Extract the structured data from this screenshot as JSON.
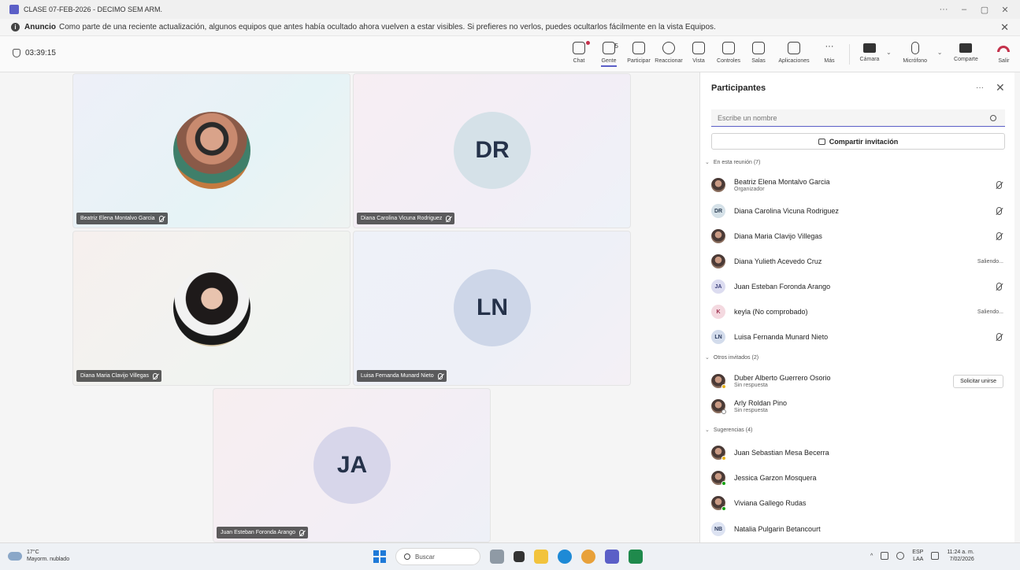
{
  "window": {
    "title": "CLASE 07-FEB-2026 - DECIMO SEM ARM.",
    "controls": [
      "···",
      "–",
      "▢",
      "✕"
    ]
  },
  "announcement": {
    "bold": "Anuncio",
    "text": "Como parte de una reciente actualización, algunos equipos que antes había ocultado ahora vuelven a estar visibles. Si prefieres no verlos, puedes ocultarlos fácilmente en la vista Equipos.",
    "close": "✕"
  },
  "toolbar": {
    "timer": "03:39:15",
    "items": {
      "chat": "Chat",
      "people": "Gente",
      "people_count": "5",
      "raise": "Participar",
      "react": "Reaccionar",
      "view": "Vista",
      "controls": "Controles",
      "rooms": "Salas",
      "apps": "Aplicaciones",
      "more": "Más",
      "camera": "Cámara",
      "mic": "Micrófono",
      "share": "Comparte",
      "leave": "Salir"
    },
    "more_glyph": "···",
    "chevron": "⌄"
  },
  "stage": {
    "tiles": [
      {
        "name": "Beatriz Elena Montalvo Garcia"
      },
      {
        "name": "Diana Carolina Vicuna Rodriguez",
        "initials": "DR"
      },
      {
        "name": "Diana Maria Clavijo Villegas"
      },
      {
        "name": "Luisa Fernanda Munard Nieto",
        "initials": "LN"
      },
      {
        "name": "Juan Esteban Foronda Arango",
        "initials": "JA"
      }
    ]
  },
  "panel": {
    "title": "Participantes",
    "more": "···",
    "close": "✕",
    "search_placeholder": "Escribe un nombre",
    "invite": "Compartir invitación",
    "section_in": "En esta reunión (7)",
    "section_others": "Otros invitados (2)",
    "section_suggest": "Sugerencias (4)",
    "chevron": "⌄",
    "in_meeting": [
      {
        "name": "Beatriz Elena Montalvo Garcia",
        "sub": "Organizador"
      },
      {
        "name": "Diana Carolina Vicuna Rodriguez",
        "initials": "DR"
      },
      {
        "name": "Diana Maria Clavijo Villegas"
      },
      {
        "name": "Diana Yulieth Acevedo Cruz",
        "status": "Saliendo..."
      },
      {
        "name": "Juan Esteban Foronda Arango",
        "initials": "JA"
      },
      {
        "name": "keyla (No comprobado)",
        "initials": "K",
        "status": "Saliendo..."
      },
      {
        "name": "Luisa Fernanda Munard Nieto",
        "initials": "LN"
      }
    ],
    "others": [
      {
        "name": "Duber Alberto Guerrero Osorio",
        "sub": "Sin respuesta",
        "action": "Solicitar unirse"
      },
      {
        "name": "Arly Roldan Pino",
        "sub": "Sin respuesta"
      }
    ],
    "suggestions": [
      {
        "name": "Juan Sebastian Mesa Becerra"
      },
      {
        "name": "Jessica Garzon Mosquera"
      },
      {
        "name": "Viviana Gallego Rudas"
      },
      {
        "name": "Natalia Pulgarin Betancourt",
        "initials": "NB"
      }
    ]
  },
  "taskbar": {
    "temp": "17°C",
    "weather": "Mayorm. nublado",
    "search": "Buscar",
    "tray_caret": "^",
    "lang1": "ESP",
    "lang2": "LAA",
    "time": "11:24 a. m.",
    "date": "7/02/2026"
  }
}
